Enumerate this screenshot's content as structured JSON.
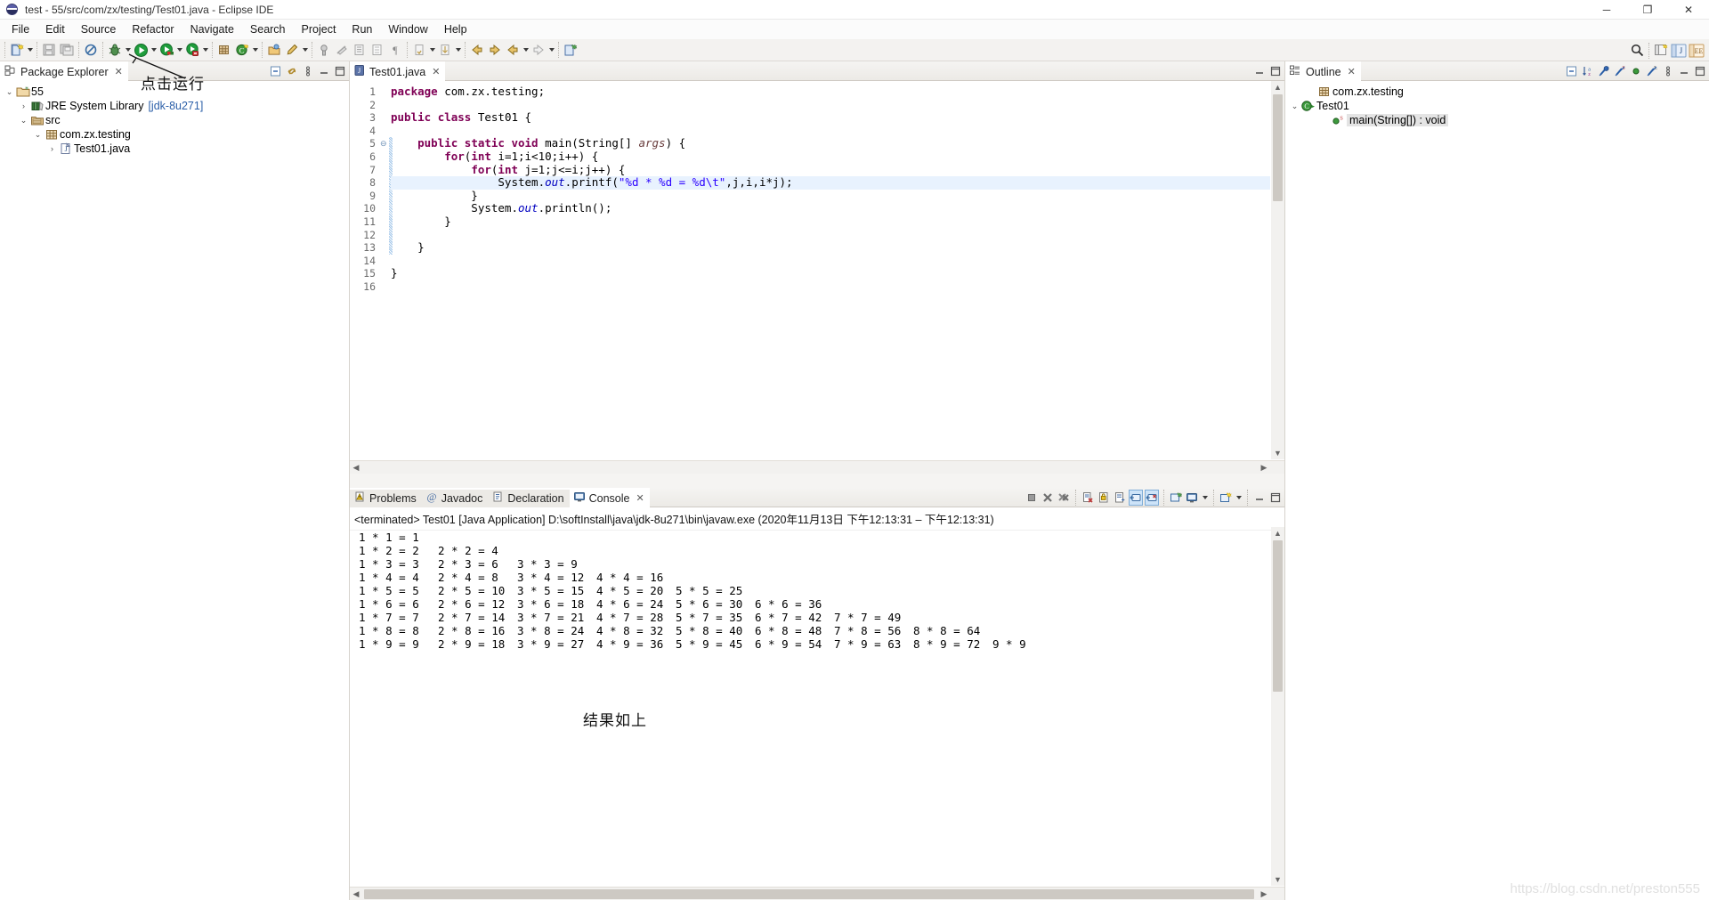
{
  "window": {
    "title": "test - 55/src/com/zx/testing/Test01.java - Eclipse IDE",
    "app_icon": "eclipse-globe-icon",
    "minimize": "─",
    "maximize": "❐",
    "close": "✕"
  },
  "menubar": {
    "items": [
      "File",
      "Edit",
      "Source",
      "Refactor",
      "Navigate",
      "Search",
      "Project",
      "Run",
      "Window",
      "Help"
    ]
  },
  "toolbar": {
    "left_buttons": [
      {
        "name": "new-wizard-icon"
      },
      {
        "name": "new-wizard-dropdown-icon"
      },
      {
        "name": "save-icon"
      },
      {
        "name": "save-all-icon"
      },
      {
        "name": "no-edit-icon"
      },
      {
        "name": "debug-icon"
      },
      {
        "name": "debug-dropdown-icon"
      },
      {
        "name": "run-icon"
      },
      {
        "name": "run-dropdown-icon"
      },
      {
        "name": "coverage-icon"
      },
      {
        "name": "coverage-dropdown-icon"
      },
      {
        "name": "run-external-tools-icon"
      },
      {
        "name": "external-tools-dropdown-icon"
      },
      {
        "name": "new-java-package-icon"
      },
      {
        "name": "new-java-class-icon"
      },
      {
        "name": "new-class-dropdown-icon"
      },
      {
        "name": "open-type-icon"
      },
      {
        "name": "search-icon"
      },
      {
        "name": "search-dropdown-icon"
      },
      {
        "name": "toggle-mark-occurrences-icon"
      },
      {
        "name": "skip-all-breakpoints-icon"
      },
      {
        "name": "next-annotation-icon"
      },
      {
        "name": "previous-annotation-icon"
      },
      {
        "name": "pilcrow-icon"
      },
      {
        "name": "last-edit-location-icon"
      },
      {
        "name": "last-edit-dropdown-icon"
      },
      {
        "name": "next-edit-icon"
      },
      {
        "name": "next-edit-dropdown-icon"
      },
      {
        "name": "back-icon"
      },
      {
        "name": "forward-icon"
      },
      {
        "name": "back-history-icon"
      },
      {
        "name": "back-history-dropdown-icon"
      },
      {
        "name": "forward-history-icon"
      },
      {
        "name": "forward-history-dropdown-icon"
      }
    ],
    "right_buttons": [
      {
        "name": "quick-access-search-icon"
      },
      {
        "name": "open-perspective-icon"
      },
      {
        "name": "java-perspective-icon"
      },
      {
        "name": "java-ee-perspective-icon"
      }
    ]
  },
  "annotation": {
    "run_hint": "点击运行",
    "console_hint": "结果如上"
  },
  "package_explorer": {
    "tab_label": "Package Explorer",
    "tab_close": "✕",
    "tools": [
      "collapse-all-icon",
      "link-with-editor-icon",
      "view-menu-icon",
      "minimize-icon",
      "maximize-icon"
    ],
    "tree": [
      {
        "indent": 0,
        "twisty": "⌄",
        "icon": "project-folder-icon",
        "label": "55",
        "suffix": ""
      },
      {
        "indent": 1,
        "twisty": "›",
        "icon": "jre-library-icon",
        "label": "JRE System Library",
        "suffix": "[jdk-8u271]"
      },
      {
        "indent": 1,
        "twisty": "⌄",
        "icon": "source-folder-icon",
        "label": "src",
        "suffix": ""
      },
      {
        "indent": 2,
        "twisty": "⌄",
        "icon": "package-icon",
        "label": "com.zx.testing",
        "suffix": ""
      },
      {
        "indent": 3,
        "twisty": "›",
        "icon": "java-file-icon",
        "label": "Test01.java",
        "suffix": ""
      }
    ]
  },
  "editor": {
    "tab_label": "Test01.java",
    "tab_icon": "java-file-icon",
    "tab_close": "✕",
    "tools": [
      "minimize-icon",
      "maximize-icon"
    ],
    "lines": [
      {
        "no": 1,
        "fold": "",
        "highlight": false,
        "changed": false
      },
      {
        "no": 2,
        "fold": "",
        "highlight": false,
        "changed": false
      },
      {
        "no": 3,
        "fold": "",
        "highlight": false,
        "changed": false
      },
      {
        "no": 4,
        "fold": "",
        "highlight": false,
        "changed": false
      },
      {
        "no": 5,
        "fold": "⊖",
        "highlight": false,
        "changed": true
      },
      {
        "no": 6,
        "fold": "",
        "highlight": false,
        "changed": true
      },
      {
        "no": 7,
        "fold": "",
        "highlight": false,
        "changed": true
      },
      {
        "no": 8,
        "fold": "",
        "highlight": true,
        "changed": true
      },
      {
        "no": 9,
        "fold": "",
        "highlight": false,
        "changed": true
      },
      {
        "no": 10,
        "fold": "",
        "highlight": false,
        "changed": true
      },
      {
        "no": 11,
        "fold": "",
        "highlight": false,
        "changed": true
      },
      {
        "no": 12,
        "fold": "",
        "highlight": false,
        "changed": true
      },
      {
        "no": 13,
        "fold": "",
        "highlight": false,
        "changed": true
      },
      {
        "no": 14,
        "fold": "",
        "highlight": false,
        "changed": false
      },
      {
        "no": 15,
        "fold": "",
        "highlight": false,
        "changed": false
      },
      {
        "no": 16,
        "fold": "",
        "highlight": false,
        "changed": false
      }
    ],
    "source_text": [
      "package com.zx.testing;",
      "",
      "public class Test01 {",
      "",
      "    public static void main(String[] args) {",
      "        for(int i=1;i<10;i++) {",
      "            for(int j=1;j<=i;j++) {",
      "                System.out.printf(\"%d * %d = %d\\t\",j,i,i*j);",
      "            }",
      "            System.out.println();",
      "        }",
      "",
      "    }",
      "",
      "}",
      ""
    ]
  },
  "console": {
    "tabs": [
      {
        "label": "Problems",
        "icon": "problems-icon",
        "active": false
      },
      {
        "label": "Javadoc",
        "icon": "javadoc-icon",
        "active": false
      },
      {
        "label": "Declaration",
        "icon": "declaration-icon",
        "active": false
      },
      {
        "label": "Console",
        "icon": "console-icon",
        "active": true
      }
    ],
    "tab_close": "✕",
    "tools": [
      "terminate-icon",
      "remove-launch-icon",
      "remove-all-terminated-icon",
      "clear-console-icon",
      "scroll-lock-icon",
      "word-wrap-icon",
      "show-console-on-output-icon",
      "show-console-on-error-icon",
      "pin-console-icon",
      "display-selected-console-icon",
      "display-console-dropdown-icon",
      "open-console-icon",
      "open-console-dropdown-icon",
      "minimize-icon",
      "maximize-icon"
    ],
    "terminated_line": "<terminated> Test01 [Java Application] D:\\softInstall\\java\\jdk-8u271\\bin\\javaw.exe  (2020年11月13日 下午12:13:31 – 下午12:13:31)",
    "output_rows": [
      "1 * 1 = 1\t",
      "1 * 2 = 2\t2 * 2 = 4\t",
      "1 * 3 = 3\t2 * 3 = 6\t3 * 3 = 9\t",
      "1 * 4 = 4\t2 * 4 = 8\t3 * 4 = 12\t4 * 4 = 16\t",
      "1 * 5 = 5\t2 * 5 = 10\t3 * 5 = 15\t4 * 5 = 20\t5 * 5 = 25\t",
      "1 * 6 = 6\t2 * 6 = 12\t3 * 6 = 18\t4 * 6 = 24\t5 * 6 = 30\t6 * 6 = 36\t",
      "1 * 7 = 7\t2 * 7 = 14\t3 * 7 = 21\t4 * 7 = 28\t5 * 7 = 35\t6 * 7 = 42\t7 * 7 = 49\t",
      "1 * 8 = 8\t2 * 8 = 16\t3 * 8 = 24\t4 * 8 = 32\t5 * 8 = 40\t6 * 8 = 48\t7 * 8 = 56\t8 * 8 = 64\t",
      "1 * 9 = 9\t2 * 9 = 18\t3 * 9 = 27\t4 * 9 = 36\t5 * 9 = 45\t6 * 9 = 54\t7 * 9 = 63\t8 * 9 = 72\t9 * 9"
    ]
  },
  "outline": {
    "tab_label": "Outline",
    "tab_close": "✕",
    "tools": [
      "collapse-all-icon",
      "sort-icon",
      "hide-non-public-icon",
      "hide-static-icon",
      "hide-fields-icon",
      "hide-local-types-icon",
      "view-menu-icon",
      "minimize-icon",
      "maximize-icon"
    ],
    "tree": [
      {
        "indent": 1,
        "twisty": "",
        "icon": "package-icon",
        "label": "com.zx.testing",
        "selected": false
      },
      {
        "indent": 0,
        "twisty": "⌄",
        "icon": "class-icon",
        "label": "Test01",
        "selected": false
      },
      {
        "indent": 2,
        "twisty": "",
        "icon": "public-method-static-icon",
        "label": "main(String[]) : void",
        "selected": true
      }
    ]
  },
  "watermark": "https://blog.csdn.net/preston555",
  "colors": {
    "keyword": "#7f0055",
    "string": "#2a00ff",
    "field": "#0000c0",
    "link": "#2b5fa8",
    "highlight_line": "#e8f2fe",
    "selection": "#e4e4e4"
  }
}
